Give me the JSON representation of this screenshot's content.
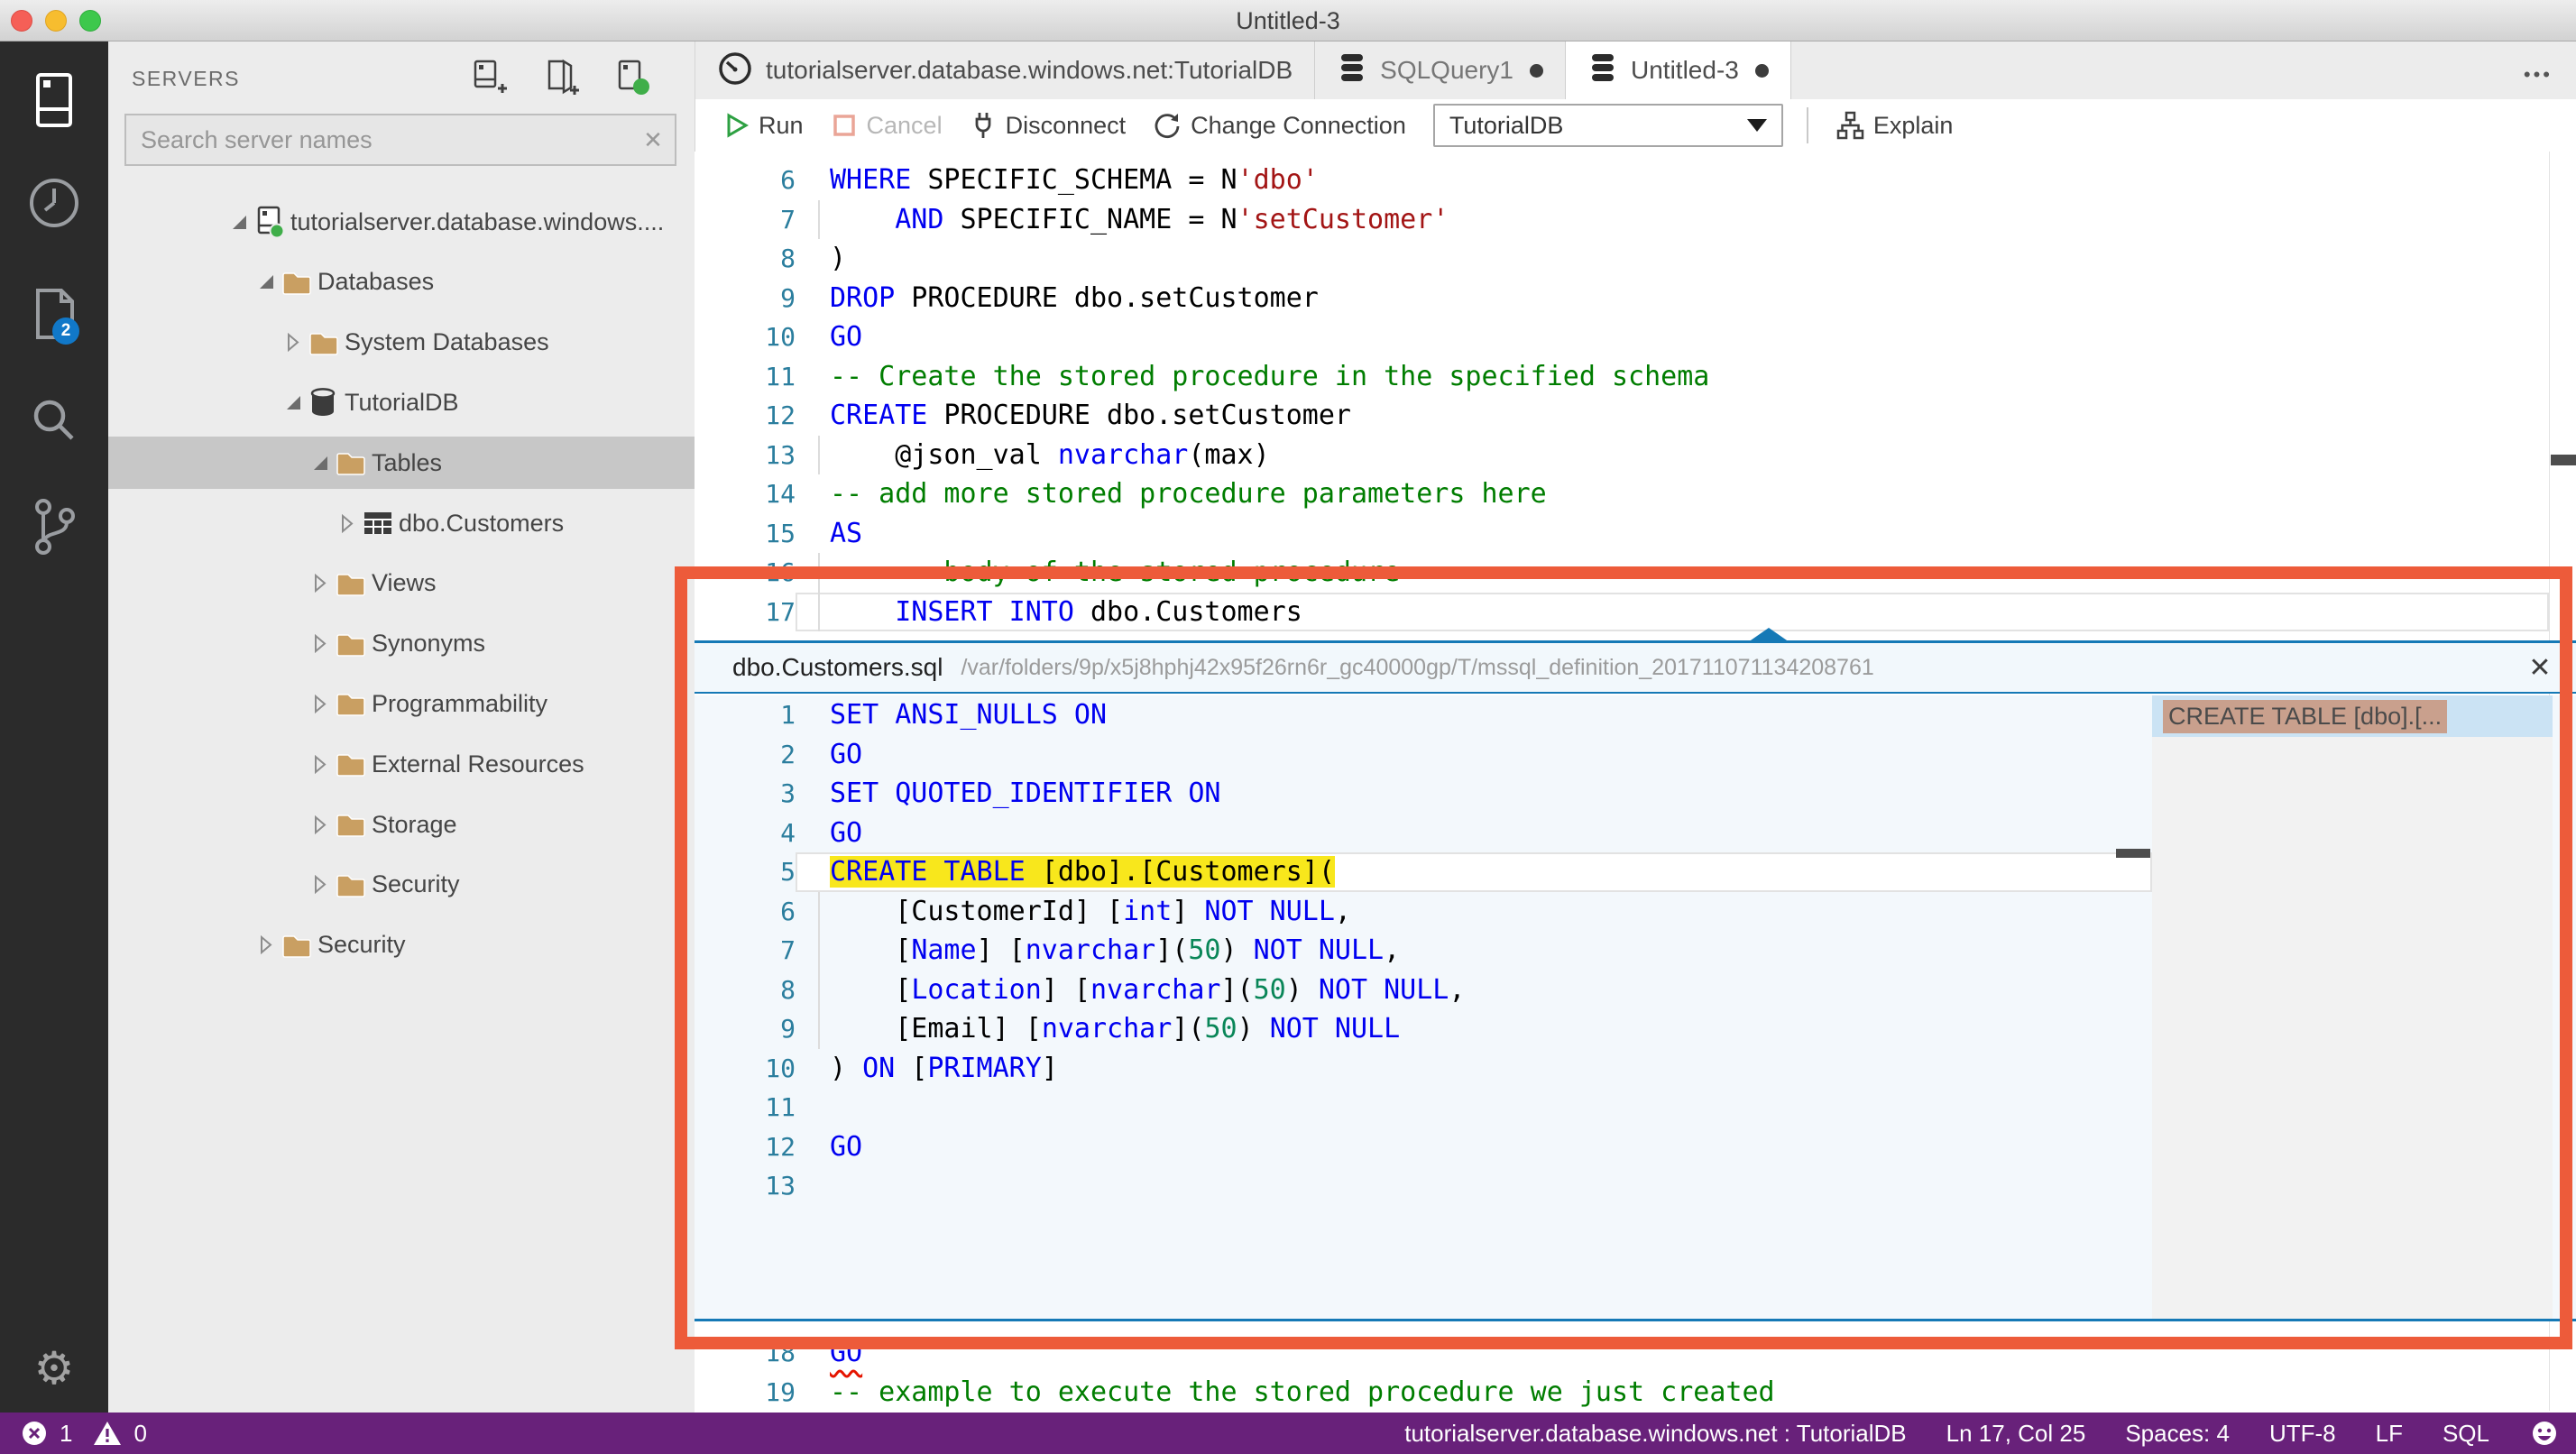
{
  "window": {
    "title": "Untitled-3"
  },
  "activity_bar": {
    "badge_count": "2"
  },
  "sidebar": {
    "title": "SERVERS",
    "search": {
      "placeholder": "Search server names"
    },
    "tree": [
      {
        "label": "tutorialserver.database.windows....",
        "level": 1,
        "state": "expanded",
        "icon": "server",
        "selected": false
      },
      {
        "label": "Databases",
        "level": 2,
        "state": "expanded",
        "icon": "folder",
        "selected": false
      },
      {
        "label": "System Databases",
        "level": 3,
        "state": "collapsed",
        "icon": "folder",
        "selected": false
      },
      {
        "label": "TutorialDB",
        "level": 3,
        "state": "expanded",
        "icon": "database",
        "selected": false
      },
      {
        "label": "Tables",
        "level": 4,
        "state": "expanded",
        "icon": "folder",
        "selected": true
      },
      {
        "label": "dbo.Customers",
        "level": 5,
        "state": "collapsed",
        "icon": "table",
        "selected": false
      },
      {
        "label": "Views",
        "level": 4,
        "state": "collapsed",
        "icon": "folder",
        "selected": false
      },
      {
        "label": "Synonyms",
        "level": 4,
        "state": "collapsed",
        "icon": "folder",
        "selected": false
      },
      {
        "label": "Programmability",
        "level": 4,
        "state": "collapsed",
        "icon": "folder",
        "selected": false
      },
      {
        "label": "External Resources",
        "level": 4,
        "state": "collapsed",
        "icon": "folder",
        "selected": false
      },
      {
        "label": "Storage",
        "level": 4,
        "state": "collapsed",
        "icon": "folder",
        "selected": false
      },
      {
        "label": "Security",
        "level": 4,
        "state": "collapsed",
        "icon": "folder",
        "selected": false
      },
      {
        "label": "Security",
        "level": 2,
        "state": "collapsed",
        "icon": "folder",
        "selected": false
      }
    ]
  },
  "tabs": {
    "items": [
      {
        "label": "tutorialserver.database.windows.net:TutorialDB",
        "icon": "dashboard",
        "dirty": false,
        "active": false
      },
      {
        "label": "SQLQuery1",
        "icon": "database",
        "dirty": true,
        "active": false
      },
      {
        "label": "Untitled-3",
        "icon": "database",
        "dirty": true,
        "active": true
      }
    ]
  },
  "toolbar": {
    "run": "Run",
    "cancel": "Cancel",
    "disconnect": "Disconnect",
    "change_connection": "Change Connection",
    "database_dropdown": {
      "value": "TutorialDB"
    },
    "explain": "Explain"
  },
  "editor": {
    "main_lines": [
      {
        "n": 6,
        "segs": [
          [
            "kw",
            "WHERE"
          ],
          [
            "pl",
            " SPECIFIC_SCHEMA = N"
          ],
          [
            "str",
            "'dbo'"
          ]
        ]
      },
      {
        "n": 7,
        "guide": true,
        "segs": [
          [
            "pl",
            "    "
          ],
          [
            "kw",
            "AND"
          ],
          [
            "pl",
            " SPECIFIC_NAME = N"
          ],
          [
            "str",
            "'setCustomer'"
          ]
        ]
      },
      {
        "n": 8,
        "segs": [
          [
            "pl",
            ")"
          ]
        ]
      },
      {
        "n": 9,
        "segs": [
          [
            "kw",
            "DROP"
          ],
          [
            "pl",
            " PROCEDURE dbo.setCustomer"
          ]
        ]
      },
      {
        "n": 10,
        "segs": [
          [
            "kw",
            "GO"
          ]
        ]
      },
      {
        "n": 11,
        "segs": [
          [
            "cm",
            "-- Create the stored procedure in the specified schema"
          ]
        ]
      },
      {
        "n": 12,
        "segs": [
          [
            "kw",
            "CREATE"
          ],
          [
            "pl",
            " PROCEDURE dbo.setCustomer"
          ]
        ]
      },
      {
        "n": 13,
        "guide": true,
        "segs": [
          [
            "pl",
            "    @json_val "
          ],
          [
            "kw",
            "nvarchar"
          ],
          [
            "pl",
            "(max)"
          ]
        ]
      },
      {
        "n": 14,
        "segs": [
          [
            "cm",
            "-- add more stored procedure parameters here"
          ]
        ]
      },
      {
        "n": 15,
        "segs": [
          [
            "kw",
            "AS"
          ]
        ]
      },
      {
        "n": 16,
        "guide": true,
        "segs": [
          [
            "pl",
            "    "
          ],
          [
            "cm",
            "-- body of the stored procedure"
          ]
        ]
      },
      {
        "n": 17,
        "guide": true,
        "current": true,
        "segs": [
          [
            "pl",
            "    "
          ],
          [
            "kw",
            "INSERT INTO"
          ],
          [
            "pl",
            " dbo.Customers"
          ]
        ]
      }
    ],
    "tail_lines": [
      {
        "n": 18,
        "segs": [
          [
            "kwe",
            "GO"
          ]
        ]
      },
      {
        "n": 19,
        "segs": [
          [
            "cm",
            "-- example to execute the stored procedure we just created"
          ]
        ]
      }
    ],
    "peek": {
      "file": "dbo.Customers.sql",
      "path": "/var/folders/9p/x5j8hphj42x95f26rn6r_gc40000gp/T/mssql_definition_201711071134208761",
      "reference": {
        "label": "CREATE TABLE [dbo].[..."
      },
      "lines": [
        {
          "n": 1,
          "segs": [
            [
              "kw",
              "SET ANSI_NULLS ON"
            ]
          ]
        },
        {
          "n": 2,
          "segs": [
            [
              "kw",
              "GO"
            ]
          ]
        },
        {
          "n": 3,
          "segs": [
            [
              "kw",
              "SET QUOTED_IDENTIFIER ON"
            ]
          ]
        },
        {
          "n": 4,
          "segs": [
            [
              "kw",
              "GO"
            ]
          ]
        },
        {
          "n": 5,
          "current": true,
          "hl": true,
          "segs": [
            [
              "kw",
              "CREATE TABLE"
            ],
            [
              "pl",
              " [dbo].[Customers]("
            ]
          ]
        },
        {
          "n": 6,
          "guide": true,
          "segs": [
            [
              "pl",
              "    [CustomerId] ["
            ],
            [
              "kw",
              "int"
            ],
            [
              "pl",
              "] "
            ],
            [
              "kw",
              "NOT NULL"
            ],
            [
              "pl",
              ","
            ]
          ]
        },
        {
          "n": 7,
          "guide": true,
          "segs": [
            [
              "pl",
              "    ["
            ],
            [
              "kw",
              "Name"
            ],
            [
              "pl",
              "] ["
            ],
            [
              "kw",
              "nvarchar"
            ],
            [
              "pl",
              "]("
            ],
            [
              "num",
              "50"
            ],
            [
              "pl",
              ") "
            ],
            [
              "kw",
              "NOT NULL"
            ],
            [
              "pl",
              ","
            ]
          ]
        },
        {
          "n": 8,
          "guide": true,
          "segs": [
            [
              "pl",
              "    ["
            ],
            [
              "kw",
              "Location"
            ],
            [
              "pl",
              "] ["
            ],
            [
              "kw",
              "nvarchar"
            ],
            [
              "pl",
              "]("
            ],
            [
              "num",
              "50"
            ],
            [
              "pl",
              ") "
            ],
            [
              "kw",
              "NOT NULL"
            ],
            [
              "pl",
              ","
            ]
          ]
        },
        {
          "n": 9,
          "guide": true,
          "segs": [
            [
              "pl",
              "    [Email] ["
            ],
            [
              "kw",
              "nvarchar"
            ],
            [
              "pl",
              "]("
            ],
            [
              "num",
              "50"
            ],
            [
              "pl",
              ") "
            ],
            [
              "kw",
              "NOT NULL"
            ]
          ]
        },
        {
          "n": 10,
          "segs": [
            [
              "pl",
              ") "
            ],
            [
              "kw",
              "ON"
            ],
            [
              "pl",
              " ["
            ],
            [
              "kw",
              "PRIMARY"
            ],
            [
              "pl",
              "]"
            ]
          ]
        },
        {
          "n": 11,
          "segs": []
        },
        {
          "n": 12,
          "segs": [
            [
              "kw",
              "GO"
            ]
          ]
        },
        {
          "n": 13,
          "segs": []
        }
      ]
    }
  },
  "status_bar": {
    "errors": "1",
    "warnings": "0",
    "connection": "tutorialserver.database.windows.net : TutorialDB",
    "cursor": "Ln 17, Col 25",
    "indent": "Spaces: 4",
    "encoding": "UTF-8",
    "eol": "LF",
    "language": "SQL"
  },
  "colors": {
    "accent_blue": "#1579b6",
    "status_purple": "#68217a",
    "highlight_yellow": "#f8e71c",
    "annotation_orange": "#ed5b3a",
    "keyword": "#0000f0",
    "string": "#a31515",
    "comment": "#007d00",
    "number": "#098658"
  }
}
